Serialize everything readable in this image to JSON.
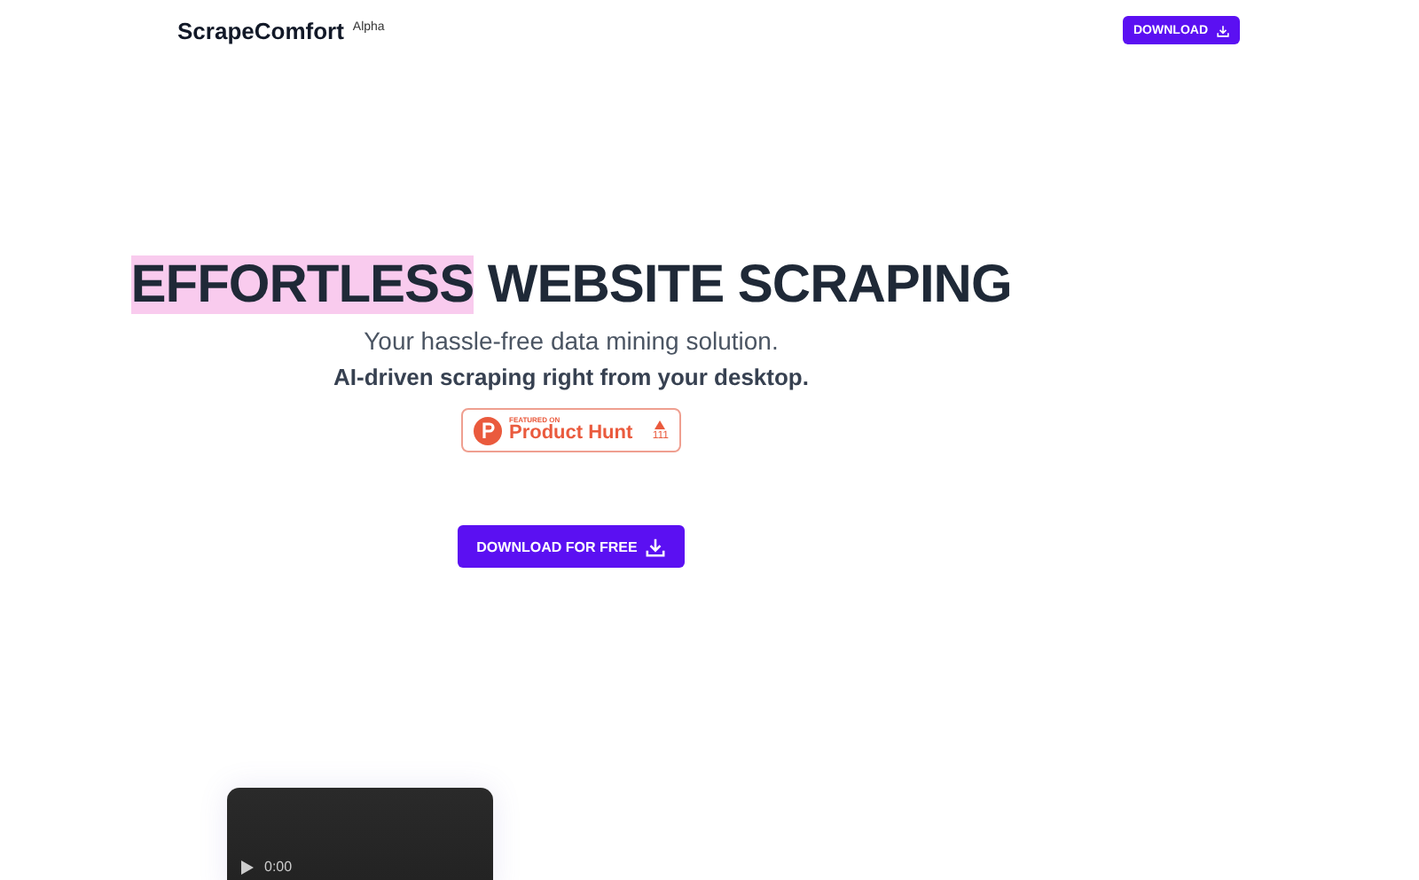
{
  "nav": {
    "logo": "ScrapeComfort",
    "tag": "Alpha",
    "button": "DOWNLOAD"
  },
  "hero": {
    "title_highlight": "EFFORTLESS",
    "title_rest": "WEBSITE SCRAPING",
    "subtitle": "Your hassle-free data mining solution.",
    "tagline": "AI-driven scraping right from your desktop.",
    "product_hunt": {
      "small": "FEATURED ON",
      "name": "Product Hunt",
      "count": "111"
    },
    "cta": "DOWNLOAD FOR FREE"
  },
  "video": {
    "time": "0:00"
  }
}
